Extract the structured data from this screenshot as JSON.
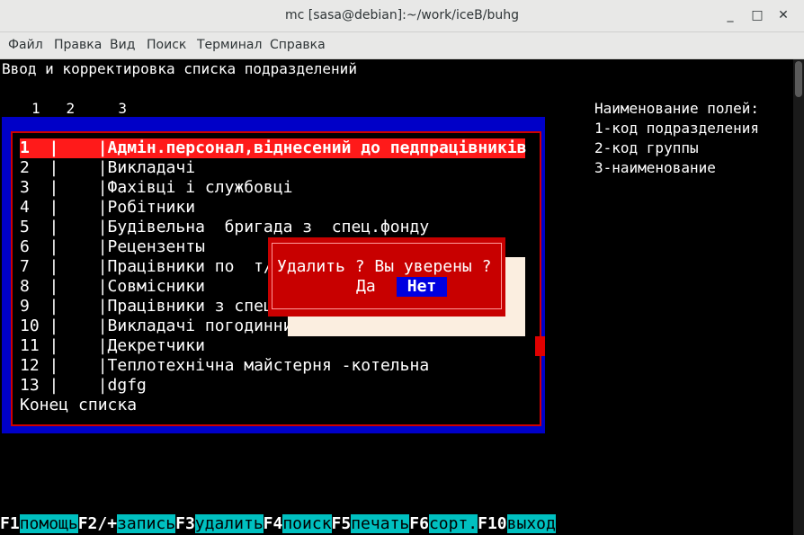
{
  "window": {
    "title": "mc [sasa@debian]:~/work/iceB/buhg",
    "minimize_glyph": "_",
    "maximize_glyph": "□",
    "close_glyph": "✕"
  },
  "menu": [
    "Файл",
    "Правка",
    "Вид",
    "Поиск",
    "Терминал",
    "Справка"
  ],
  "screen": {
    "heading": "Ввод и корректировка списка подразделений",
    "column_numbers": "1   2     3",
    "field_names": {
      "title": "Наименование полей:",
      "items": [
        "1-код подразделения",
        "2-код группы",
        "3-наименование"
      ]
    }
  },
  "list": {
    "rows": [
      "1  |    |Адмін.персонал,віднесений до педпрацівників",
      "2  |    |Викладачі",
      "3  |    |Фахівці і службовці",
      "4  |    |Робітники",
      "5  |    |Будівельна  бригада з  спец.фонду",
      "6  |    |Рецензенты",
      "7  |    |Працівники по  т/",
      "8  |    |Совмісники",
      "9  |    |Працівники з спец",
      "10 |    |Викладачі погодинни",
      "11 |    |Декретчики",
      "12 |    |Теплотехнічна майстерня -котельна",
      "13 |    |dgfg"
    ],
    "end_label": "Конец списка"
  },
  "dialog": {
    "question": "Удалить ? Вы уверены ?",
    "yes": "Да",
    "no": "Нет"
  },
  "fkeys": [
    {
      "key": "F1",
      "label": "помощь"
    },
    {
      "key": "F2/+",
      "label": "запись"
    },
    {
      "key": "F3",
      "label": "удалить"
    },
    {
      "key": "F4",
      "label": "поиск"
    },
    {
      "key": "F5",
      "label": "печать"
    },
    {
      "key": "F6",
      "label": "сорт."
    },
    {
      "key": "F10",
      "label": "выход"
    }
  ],
  "colors": {
    "frame_blue": "#0000c8",
    "frame_red": "#d00000",
    "selection_red": "#ff1a1a",
    "dialog_red": "#c80000",
    "button_blue": "#0000e0",
    "fkey_label_cyan": "#00c0c0"
  }
}
